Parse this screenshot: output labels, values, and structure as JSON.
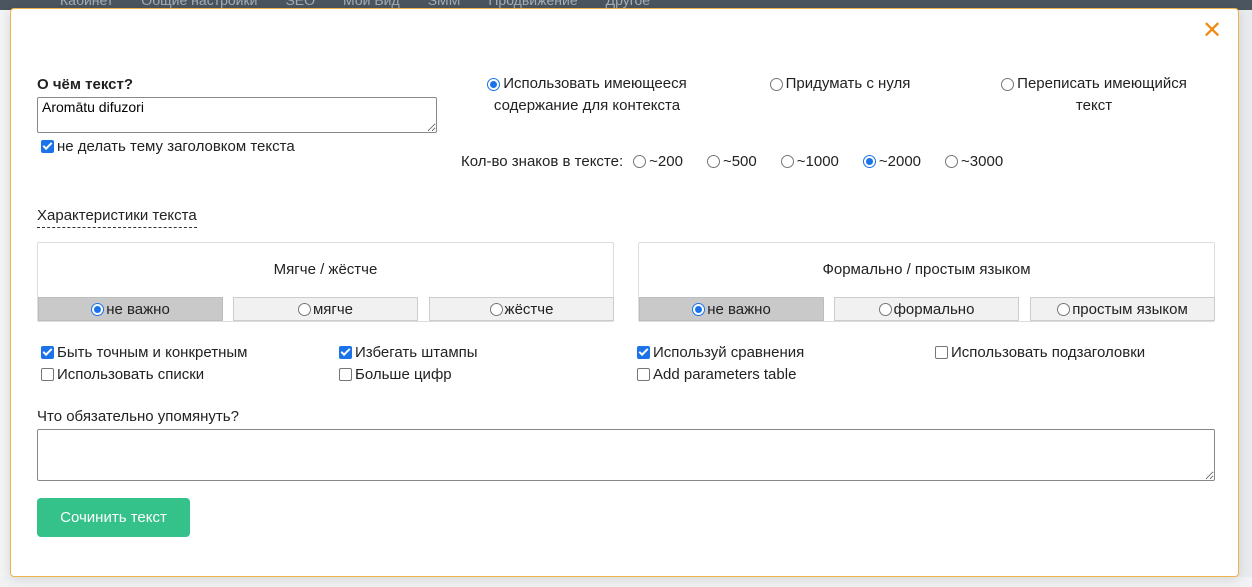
{
  "background": {
    "menu": [
      "Кабинет",
      "Общие настройки",
      "SEO",
      "Мой Вид",
      "SMM",
      "Продвижение",
      "Другое"
    ]
  },
  "modal": {
    "close_icon": "close-x-icon",
    "accent_color": "#f28c13",
    "topic": {
      "label": "О чём текст?",
      "value": "Aromātu difuzori",
      "no_title_checkbox": {
        "label": "не делать тему заголовком текста",
        "checked": true
      }
    },
    "mode": {
      "options": [
        {
          "label_line1": "Использовать имеющееся",
          "label_line2": "содержание для контекста",
          "selected": true
        },
        {
          "label_line1": "Придумать с нуля",
          "label_line2": "",
          "selected": false
        },
        {
          "label_line1": "Переписать имеющийся",
          "label_line2": "текст",
          "selected": false
        }
      ]
    },
    "length": {
      "label": "Кол-во знаков в тексте:",
      "options": [
        {
          "label": "~200",
          "selected": false
        },
        {
          "label": "~500",
          "selected": false
        },
        {
          "label": "~1000",
          "selected": false
        },
        {
          "label": "~2000",
          "selected": true
        },
        {
          "label": "~3000",
          "selected": false
        }
      ]
    },
    "characteristics": {
      "header": "Характеристики текста",
      "tone": {
        "title": "Мягче / жёстче",
        "options": [
          {
            "label": "не важно",
            "selected": true
          },
          {
            "label": "мягче",
            "selected": false
          },
          {
            "label": "жёстче",
            "selected": false
          }
        ]
      },
      "style": {
        "title": "Формально / простым языком",
        "options": [
          {
            "label": "не важно",
            "selected": true
          },
          {
            "label": "формально",
            "selected": false
          },
          {
            "label": "простым языком",
            "selected": false
          }
        ]
      }
    },
    "options": [
      {
        "label": "Быть точным и конкретным",
        "checked": true
      },
      {
        "label": "Избегать штампы",
        "checked": true
      },
      {
        "label": "Используй сравнения",
        "checked": true
      },
      {
        "label": "Использовать подзаголовки",
        "checked": false
      },
      {
        "label": "Использовать списки",
        "checked": false
      },
      {
        "label": "Больше цифр",
        "checked": false
      },
      {
        "label": "Add parameters table",
        "checked": false
      }
    ],
    "mention": {
      "label": "Что обязательно упомянуть?",
      "value": ""
    },
    "submit": {
      "label": "Сочинить текст",
      "color": "#34c18a"
    }
  }
}
